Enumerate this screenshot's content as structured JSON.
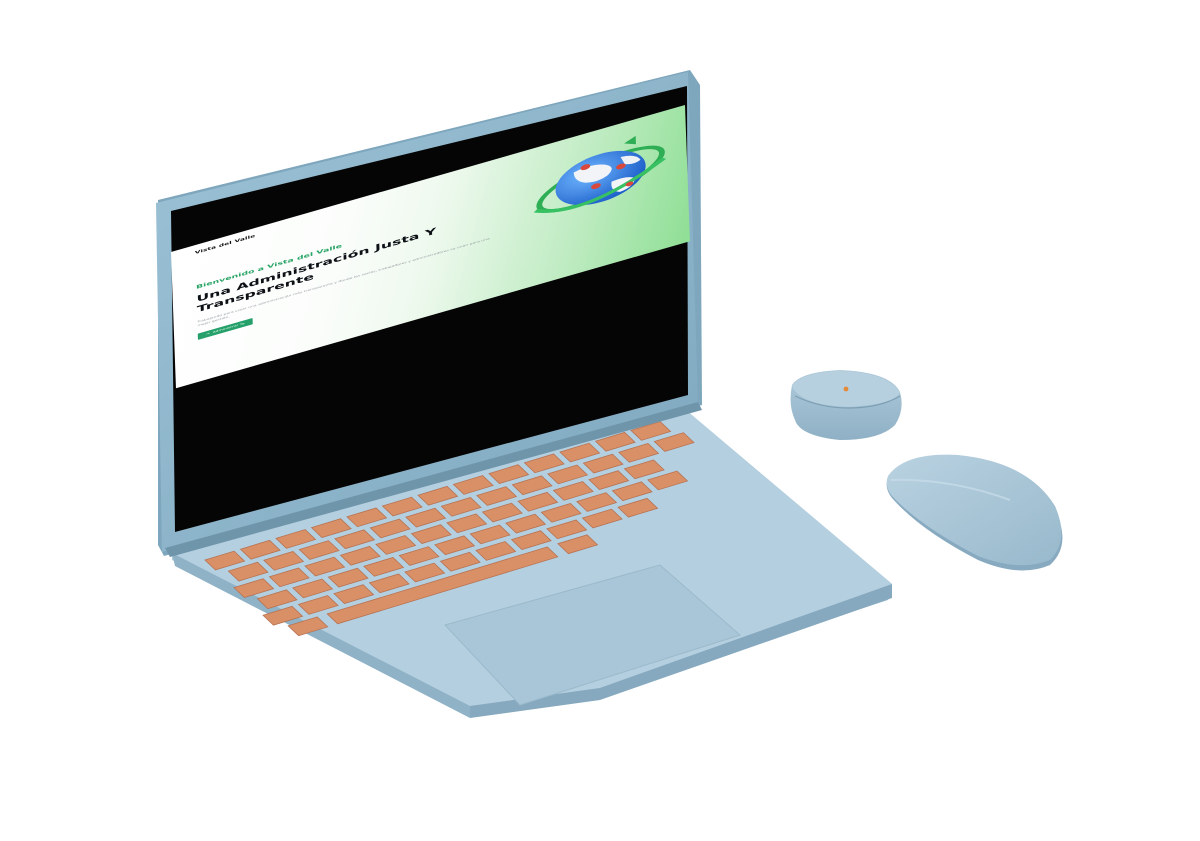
{
  "site": {
    "brand": "Vista del Valle",
    "eyebrow": "Bienvenido a Vista del Valle",
    "headline": "Una Administración Justa Y Transparente",
    "description": "Trabajando para crear una administración más transparente y donde los socios, trabajadores y administradores se unan para una mejor gestión.",
    "cta_label": "Administrar Ya",
    "cta_icon": "arrow-right-icon"
  },
  "devices": {
    "laptop_color": "#8fb6cb",
    "keycap_color": "#d99067",
    "case_color": "#a7c4d6",
    "mouse_color": "#a9c6d8",
    "led_color": "#e58a37"
  },
  "colors": {
    "accent": "#25a06a",
    "eyebrow": "#29a466",
    "gradient_end": "#8fdf95"
  }
}
